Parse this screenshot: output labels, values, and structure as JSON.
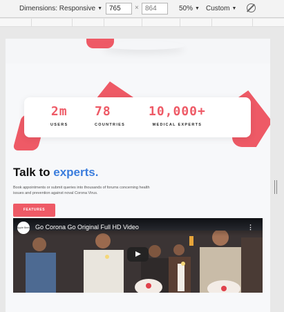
{
  "toolbar": {
    "dimensions_label": "Dimensions: Responsive",
    "width_value": "765",
    "times": "×",
    "height_placeholder": "864",
    "zoom": "50%",
    "throttle": "Custom",
    "rotate_icon": "rotate-icon"
  },
  "stats": [
    {
      "value": "2m",
      "label": "USERS"
    },
    {
      "value": "78",
      "label": "COUNTRIES"
    },
    {
      "value": "10,000+",
      "label": "MEDICAL EXPERTS"
    }
  ],
  "section": {
    "heading_main": "Talk to ",
    "heading_accent": "experts.",
    "description": "Book appointments or submit queries into thousands of forums concerning health issues and prevention against noval Corona Virus.",
    "features_button": "FEATURES"
  },
  "video": {
    "channel_logo_text": "Apple Bees",
    "title": "Go Corona Go Original Full HD Video",
    "menu_icon": "more-vert-icon",
    "play_icon": "play-icon"
  },
  "colors": {
    "accent_red": "#ee5a66",
    "accent_blue": "#3b7ddd"
  }
}
